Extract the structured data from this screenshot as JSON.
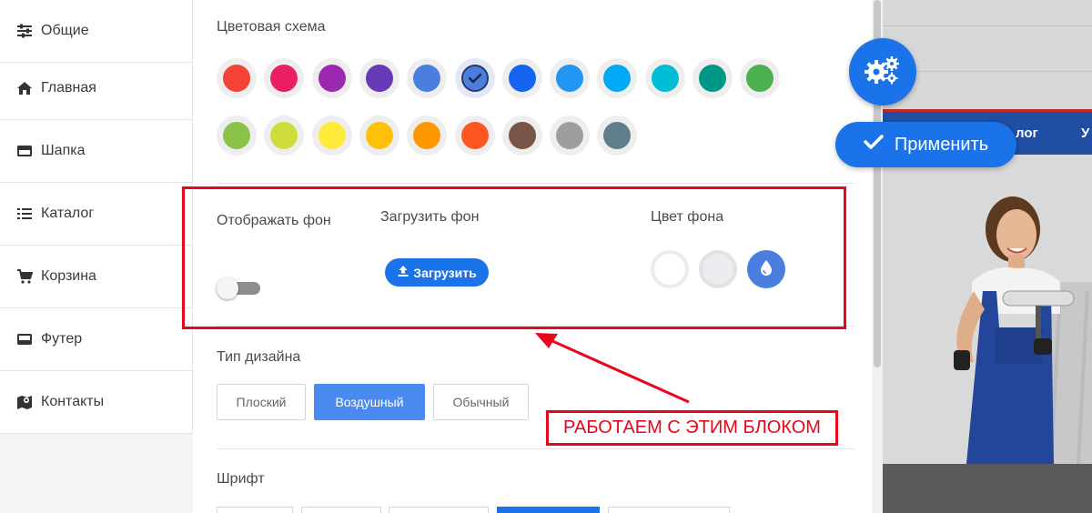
{
  "sidebar": {
    "items": [
      {
        "label": "Общие",
        "icon": "sliders-icon"
      },
      {
        "label": "Главная",
        "icon": "home-icon"
      },
      {
        "label": "Шапка",
        "icon": "header-icon"
      },
      {
        "label": "Каталог",
        "icon": "list-icon"
      },
      {
        "label": "Корзина",
        "icon": "cart-icon"
      },
      {
        "label": "Футер",
        "icon": "footer-icon"
      },
      {
        "label": "Контакты",
        "icon": "map-icon"
      }
    ]
  },
  "color_scheme": {
    "title": "Цветовая схема",
    "selected_index": 5,
    "colors": [
      "#f44336",
      "#e91e63",
      "#9c27b0",
      "#673ab7",
      "#4a7fe0",
      "#4a7fe0",
      "#1565f0",
      "#2196f3",
      "#03a9f4",
      "#00bcd4",
      "#009688",
      "#4caf50",
      "#8bc34a",
      "#cddc39",
      "#ffeb3b",
      "#ffc107",
      "#ff9800",
      "#ff5722",
      "#795548",
      "#9e9e9e",
      "#607d8b"
    ]
  },
  "background": {
    "show_label": "Отображать фон",
    "show_enabled": false,
    "upload_label": "Загрузить фон",
    "upload_button": "Загрузить",
    "color_label": "Цвет фона",
    "colors": [
      "#ffffff",
      "#eeeeee",
      "#4a7fe0"
    ]
  },
  "design_type": {
    "title": "Тип дизайна",
    "options": [
      "Плоский",
      "Воздушный",
      "Обычный"
    ],
    "selected": "Воздушный"
  },
  "font": {
    "title": "Шрифт"
  },
  "annotation": {
    "label": "РАБОТАЕМ С ЭТИМ БЛОКОМ",
    "color": "#e6071c"
  },
  "floating": {
    "apply_label": "Применить"
  },
  "preview": {
    "nav_items": [
      "лог",
      "У"
    ]
  },
  "accent_color": "#1a73e8"
}
